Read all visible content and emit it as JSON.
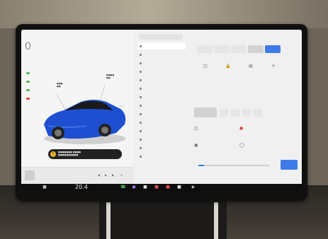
{
  "scene": {
    "wall_color": "#b5ab98",
    "bezel_color": "#101010"
  },
  "screen": {
    "speed": "0",
    "accent": "#3e7be8",
    "car_color": "#1d4fd0",
    "alert_color": "#e8b02a",
    "icons": {
      "dock_car": "car-icon",
      "dock_phone": "phone-icon",
      "dock_apps": [
        "phone-icon",
        "camera-icon",
        "app-icon",
        "bluetooth-icon",
        "music-icon",
        "calendar-icon",
        "volume-icon"
      ]
    }
  },
  "dock": {
    "temperature": "20.4"
  }
}
